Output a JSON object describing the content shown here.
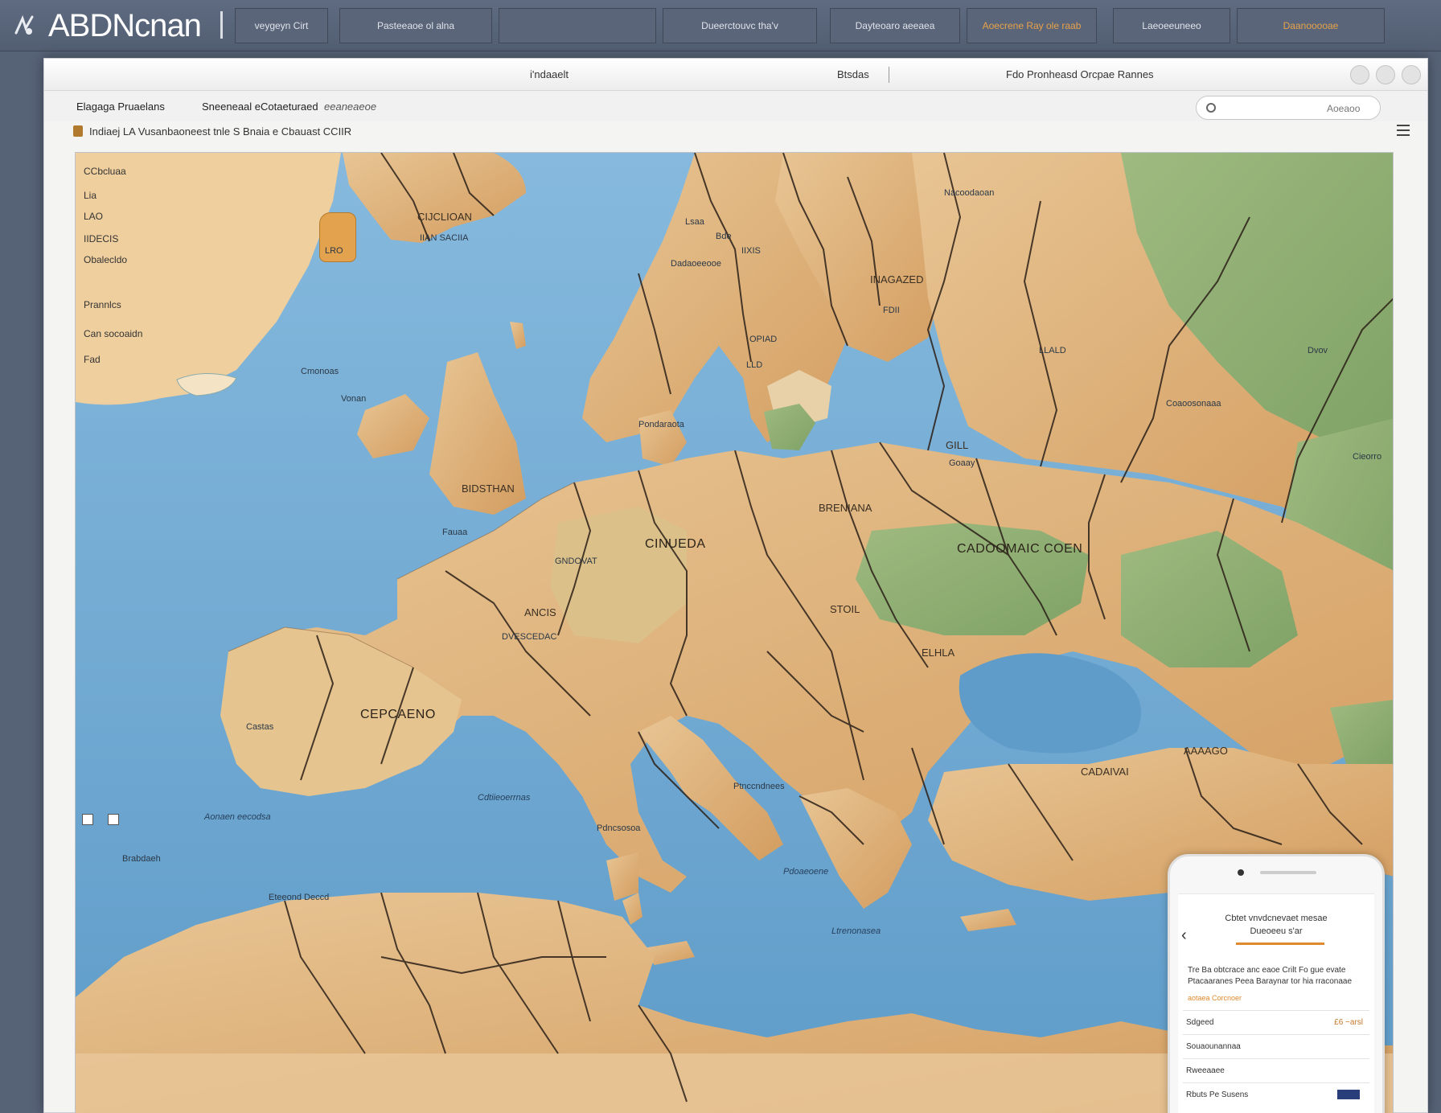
{
  "app": {
    "title": "ABDNcnan"
  },
  "topnav": {
    "tabs": [
      {
        "label": "veygeyn Cirt",
        "highlight": false
      },
      {
        "label": "Pasteeaoe ol alna",
        "highlight": false
      },
      {
        "label": "",
        "highlight": false
      },
      {
        "label": "Dueerctouvc tha'v",
        "highlight": false
      },
      {
        "label": "Dayteoaro aeeaea",
        "highlight": false
      },
      {
        "label": "Aoecrene Ray ole raab",
        "highlight": true
      },
      {
        "label": "Laeoeeuneeo",
        "highlight": false
      },
      {
        "label": "Daanooooae",
        "highlight": true
      }
    ]
  },
  "window": {
    "title_left": "i'ndaaelt",
    "title_mid": "Btsdas",
    "title_right": "Fdo Pronheasd Orcpae Rannes",
    "toolbar": {
      "item1": "Elagaga Pruaelans",
      "item2": "Sneeneaal eCotaeturaed",
      "item3": "eeaneaeoe",
      "search_placeholder": "",
      "search_label": "Aoeaoo"
    },
    "breadcrumb": "Indiaej LA Vusanbaoneest tnle S Bnaia e Cbauast CCIIR"
  },
  "map": {
    "legend": [
      "CCbcluaa",
      "Lia",
      "LAO",
      "IIDECIS",
      "Obalecldo",
      "Prannlcs",
      "Can socoaidn",
      "Fad"
    ],
    "chip_label": "LRO",
    "labels": [
      {
        "id": "iceland-top",
        "text": "CIJCLIOAN"
      },
      {
        "id": "iceland-sub",
        "text": "IIAN SACIIA"
      },
      {
        "id": "lsaa",
        "text": "Lsaa"
      },
      {
        "id": "bde",
        "text": "Bde"
      },
      {
        "id": "scandi-1",
        "text": "IIXIS"
      },
      {
        "id": "scandi-2",
        "text": "Dadaoeeooe"
      },
      {
        "id": "ortd",
        "text": "OPIAD"
      },
      {
        "id": "lld",
        "text": "LLD"
      },
      {
        "id": "finland",
        "text": "INAGAZED"
      },
      {
        "id": "fdii",
        "text": "FDII"
      },
      {
        "id": "russia-n",
        "text": "Nacoodaoan"
      },
      {
        "id": "russia",
        "text": "LLALD"
      },
      {
        "id": "uk",
        "text": "BIDSTHAN"
      },
      {
        "id": "vonan",
        "text": "Vonan"
      },
      {
        "id": "cmonoas",
        "text": "Cmonoas"
      },
      {
        "id": "pon-ta",
        "text": "Pondaraota"
      },
      {
        "id": "germany",
        "text": "CINUEDA"
      },
      {
        "id": "poland",
        "text": "BRENIANA"
      },
      {
        "id": "ukraine",
        "text": "CADOOMAIC COEN"
      },
      {
        "id": "gill",
        "text": "GILL"
      },
      {
        "id": "goady",
        "text": "Goaay"
      },
      {
        "id": "france-a",
        "text": "ANCIS"
      },
      {
        "id": "france-b",
        "text": "DVESCEDAC"
      },
      {
        "id": "france-c",
        "text": "GNDOVAT"
      },
      {
        "id": "pauaa",
        "text": "Fauaa"
      },
      {
        "id": "stoil",
        "text": "STOIL"
      },
      {
        "id": "elhla",
        "text": "ELHLA"
      },
      {
        "id": "spain",
        "text": "CEPCAENO"
      },
      {
        "id": "spain-w",
        "text": "Castas"
      },
      {
        "id": "turkey-a",
        "text": "AAAAGO"
      },
      {
        "id": "turkey-b",
        "text": "CADAIVAI"
      },
      {
        "id": "ital-sea",
        "text": "Ptnccndnees"
      },
      {
        "id": "east-1",
        "text": "Coaoosonaaa"
      },
      {
        "id": "east-2",
        "text": "Dvov"
      },
      {
        "id": "east-3",
        "text": "Cieorro"
      },
      {
        "id": "africa-a",
        "text": "Eteeond Deccd"
      },
      {
        "id": "africa-b",
        "text": "Brabdaeh"
      },
      {
        "id": "africa-c",
        "text": "Pdncsosoa"
      },
      {
        "id": "sea-1",
        "text": "Aonaen eecodsa"
      },
      {
        "id": "sea-2",
        "text": "Cdtiieoerrnas"
      },
      {
        "id": "sea-3",
        "text": "Pdoaeoene"
      },
      {
        "id": "sea-4",
        "text": "Ltrenonasea"
      }
    ]
  },
  "phone": {
    "title": "Cbtet vnvdcnevaet mesae",
    "subtitle": "Dueoeeu s'ar",
    "body": "Tre Ba obtcrace anc eaoe Crilt Fo gue evate Ptacaaranes Peea Baraynar tor hia rraconaae",
    "link": "aotaea Corcnoer",
    "rows": [
      {
        "label": "Sdgeed",
        "value": "£6 −arsl"
      },
      {
        "label": "Souaounannaa",
        "value": ""
      },
      {
        "label": "Rweeaaee",
        "value": ""
      },
      {
        "label": "Rbuts Pe Susens",
        "value": ""
      }
    ]
  },
  "colors": {
    "sea": "#73a9d2",
    "land": "#d9aa72",
    "land_light": "#e6c191",
    "green": "#8fae73",
    "border": "#2b2018",
    "accent": "#e08a2f"
  }
}
